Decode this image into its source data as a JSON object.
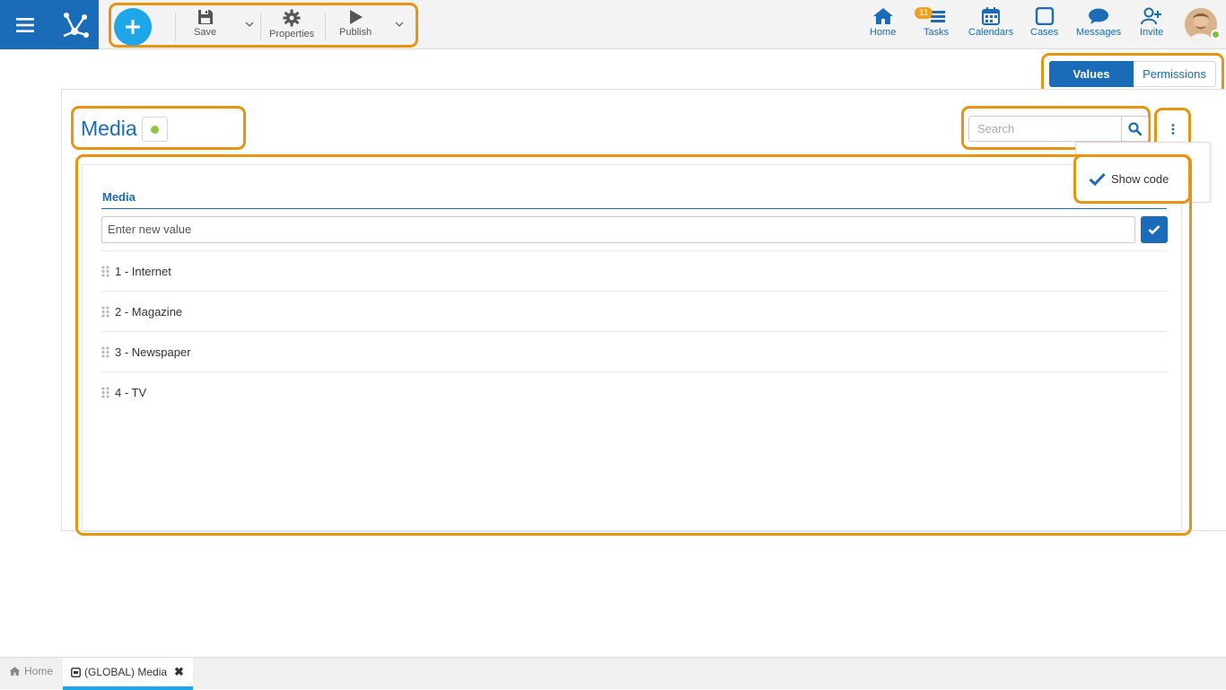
{
  "toolbar": {
    "save_label": "Save",
    "properties_label": "Properties",
    "publish_label": "Publish"
  },
  "nav": {
    "home": "Home",
    "tasks": "Tasks",
    "tasks_badge": "11",
    "calendars": "Calendars",
    "cases": "Cases",
    "messages": "Messages",
    "invite": "Invite"
  },
  "mode_tabs": {
    "values": "Values",
    "permissions": "Permissions"
  },
  "header": {
    "title": "Media"
  },
  "search": {
    "placeholder": "Search"
  },
  "menu": {
    "show_code": "Show code"
  },
  "list": {
    "header": "Media",
    "new_value_placeholder": "Enter new value",
    "items": [
      {
        "label": "1 - Internet"
      },
      {
        "label": "2 - Magazine"
      },
      {
        "label": "3 - Newspaper"
      },
      {
        "label": "4 - TV"
      }
    ]
  },
  "bottombar": {
    "home": "Home",
    "tab": "(GLOBAL) Media"
  },
  "colors": {
    "primary": "#1a6bb8",
    "accent": "#1ea7e8",
    "highlight": "#e8940f",
    "status_green": "#8dc63f"
  }
}
